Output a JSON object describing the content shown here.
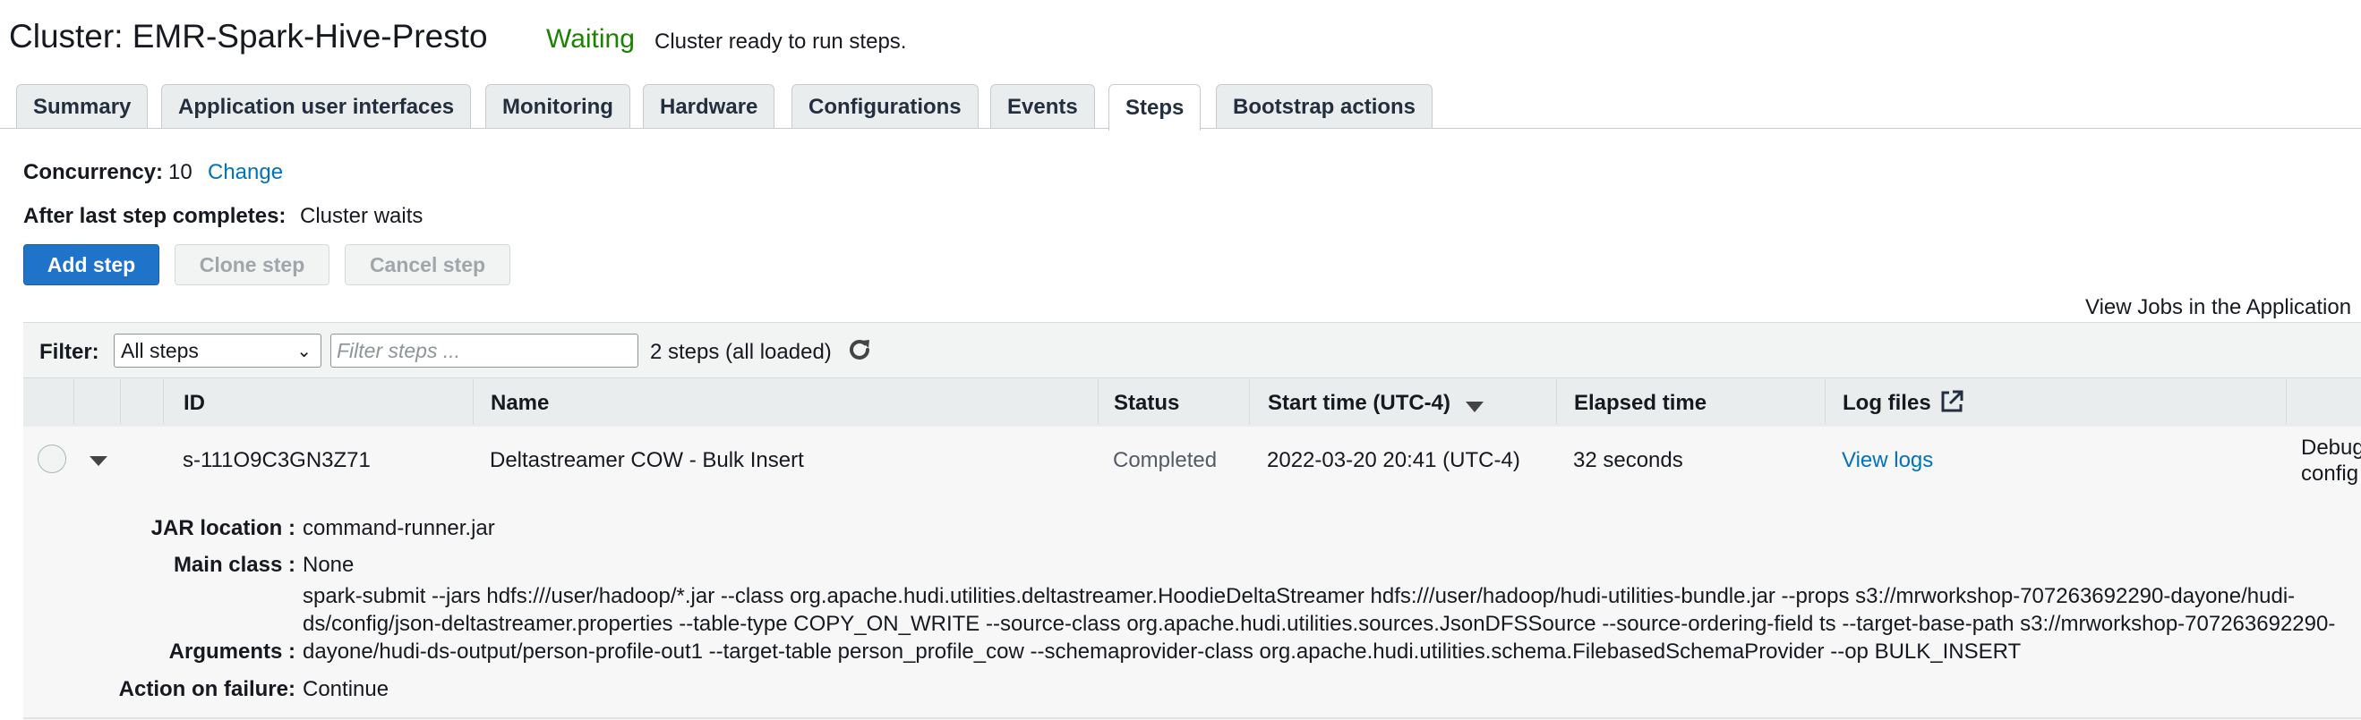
{
  "cluster": {
    "title": "Cluster: EMR-Spark-Hive-Presto",
    "status": "Waiting",
    "status_message": "Cluster ready to run steps.",
    "status_color": "#1d8102"
  },
  "tabs": [
    {
      "label": "Summary",
      "active": false
    },
    {
      "label": "Application user interfaces",
      "active": false
    },
    {
      "label": "Monitoring",
      "active": false
    },
    {
      "label": "Hardware",
      "active": false
    },
    {
      "label": "Configurations",
      "active": false
    },
    {
      "label": "Events",
      "active": false
    },
    {
      "label": "Steps",
      "active": true
    },
    {
      "label": "Bootstrap actions",
      "active": false
    }
  ],
  "settings": {
    "concurrency_label": "Concurrency:",
    "concurrency_value": "10",
    "change_link": "Change",
    "after_label": "After last step completes:",
    "after_value": "Cluster waits"
  },
  "buttons": {
    "add_step": "Add step",
    "clone_step": "Clone step",
    "cancel_step": "Cancel step"
  },
  "view_jobs_link": "View Jobs in the Application",
  "filter": {
    "label": "Filter:",
    "select_value": "All steps",
    "placeholder": "Filter steps ...",
    "count_text": "2 steps (all loaded)",
    "refresh_icon": "refresh-icon"
  },
  "table": {
    "headers": {
      "id": "ID",
      "name": "Name",
      "status": "Status",
      "start_time": "Start time (UTC-4)",
      "elapsed": "Elapsed time",
      "log_files": "Log files"
    },
    "rows": [
      {
        "id": "s-111O9C3GN3Z71",
        "name": "Deltastreamer COW - Bulk Insert",
        "status": "Completed",
        "start_time": "2022-03-20 20:41 (UTC-4)",
        "elapsed": "32 seconds",
        "log_link": "View logs",
        "extra_line1": "Debug",
        "extra_line2": "config"
      }
    ]
  },
  "details": {
    "jar_label": "JAR location :",
    "jar_value": "command-runner.jar",
    "main_class_label": "Main class :",
    "main_class_value": "None",
    "arguments_label": "Arguments :",
    "arguments_value": "spark-submit --jars hdfs:///user/hadoop/*.jar --class org.apache.hudi.utilities.deltastreamer.HoodieDeltaStreamer hdfs:///user/hadoop/hudi-utilities-bundle.jar --props s3://mrworkshop-707263692290-dayone/hudi-ds/config/json-deltastreamer.properties --table-type COPY_ON_WRITE --source-class org.apache.hudi.utilities.sources.JsonDFSSource --source-ordering-field ts --target-base-path s3://mrworkshop-707263692290-dayone/hudi-ds-output/person-profile-out1 --target-table person_profile_cow --schemaprovider-class org.apache.hudi.utilities.schema.FilebasedSchemaProvider --op BULK_INSERT",
    "action_label": "Action on failure:",
    "action_value": "Continue"
  }
}
